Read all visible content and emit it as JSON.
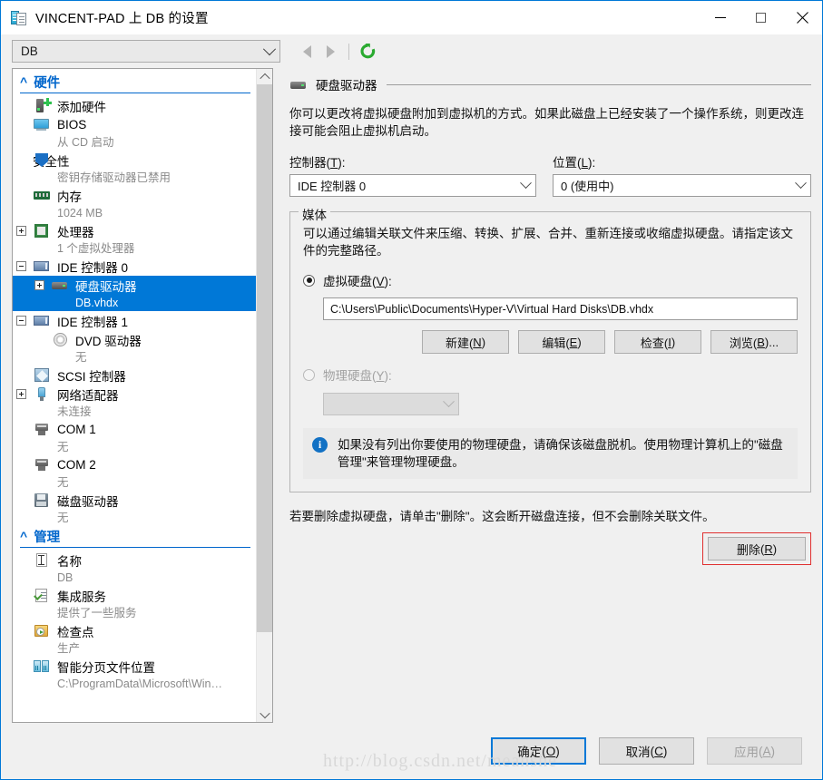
{
  "window": {
    "title": "VINCENT-PAD 上 DB 的设置",
    "icon": "vm-settings-icon",
    "minimize_label": "—",
    "maximize_label": "□",
    "close_label": "✕"
  },
  "toolbar": {
    "vm_selector_value": "DB",
    "back_icon": "back-arrow-icon",
    "forward_icon": "forward-arrow-icon",
    "refresh_icon": "refresh-icon"
  },
  "sidebar": {
    "sections": [
      {
        "title": "硬件",
        "items": [
          {
            "label": "添加硬件",
            "sub": "",
            "icon": "add-hardware-icon",
            "expander": "",
            "indent": false,
            "selected": false
          },
          {
            "label": "BIOS",
            "sub": "从 CD 启动",
            "icon": "bios-icon",
            "expander": "",
            "indent": false,
            "selected": false
          },
          {
            "label": "安全性",
            "sub": "密钥存储驱动器已禁用",
            "icon": "security-shield-icon",
            "expander": "",
            "indent": false,
            "selected": false
          },
          {
            "label": "内存",
            "sub": "1024 MB",
            "icon": "memory-icon",
            "expander": "",
            "indent": false,
            "selected": false
          },
          {
            "label": "处理器",
            "sub": "1 个虚拟处理器",
            "icon": "processor-icon",
            "expander": "plus",
            "indent": false,
            "selected": false
          },
          {
            "label": "IDE 控制器 0",
            "sub": "",
            "icon": "ide-controller-icon",
            "expander": "minus",
            "indent": false,
            "selected": false
          },
          {
            "label": "硬盘驱动器",
            "sub": "DB.vhdx",
            "icon": "hard-drive-icon",
            "expander": "plus",
            "indent": true,
            "selected": true
          },
          {
            "label": "IDE 控制器 1",
            "sub": "",
            "icon": "ide-controller-icon",
            "expander": "minus",
            "indent": false,
            "selected": false
          },
          {
            "label": "DVD 驱动器",
            "sub": "无",
            "icon": "dvd-drive-icon",
            "expander": "",
            "indent": true,
            "selected": false
          },
          {
            "label": "SCSI 控制器",
            "sub": "",
            "icon": "scsi-controller-icon",
            "expander": "",
            "indent": false,
            "selected": false
          },
          {
            "label": "网络适配器",
            "sub": "未连接",
            "icon": "network-adapter-icon",
            "expander": "plus",
            "indent": false,
            "selected": false
          },
          {
            "label": "COM 1",
            "sub": "无",
            "icon": "com-port-icon",
            "expander": "",
            "indent": false,
            "selected": false
          },
          {
            "label": "COM 2",
            "sub": "无",
            "icon": "com-port-icon",
            "expander": "",
            "indent": false,
            "selected": false
          },
          {
            "label": "磁盘驱动器",
            "sub": "无",
            "icon": "floppy-drive-icon",
            "expander": "",
            "indent": false,
            "selected": false
          }
        ]
      },
      {
        "title": "管理",
        "items": [
          {
            "label": "名称",
            "sub": "DB",
            "icon": "name-icon",
            "expander": "",
            "indent": false,
            "selected": false
          },
          {
            "label": "集成服务",
            "sub": "提供了一些服务",
            "icon": "integration-services-icon",
            "expander": "",
            "indent": false,
            "selected": false
          },
          {
            "label": "检查点",
            "sub": "生产",
            "icon": "checkpoint-icon",
            "expander": "",
            "indent": false,
            "selected": false
          },
          {
            "label": "智能分页文件位置",
            "sub": "C:\\ProgramData\\Microsoft\\Win…",
            "icon": "smart-paging-icon",
            "expander": "",
            "indent": false,
            "selected": false
          }
        ]
      }
    ]
  },
  "main": {
    "header_title": "硬盘驱动器",
    "header_icon": "hard-drive-icon",
    "description": "你可以更改将虚拟硬盘附加到虚拟机的方式。如果此磁盘上已经安装了一个操作系统，则更改连接可能会阻止虚拟机启动。",
    "controller": {
      "label": "控制器(T):",
      "label_text": "控制器",
      "accel": "T",
      "value": "IDE 控制器 0"
    },
    "location": {
      "label": "位置(L):",
      "label_text": "位置",
      "accel": "L",
      "value": "0 (使用中)"
    },
    "media": {
      "legend": "媒体",
      "description": "可以通过编辑关联文件来压缩、转换、扩展、合并、重新连接或收缩虚拟硬盘。请指定该文件的完整路径。",
      "virtual_disk": {
        "label_text": "虚拟硬盘",
        "accel": "V",
        "suffix": ":",
        "checked": true,
        "path_value": "C:\\Users\\Public\\Documents\\Hyper-V\\Virtual Hard Disks\\DB.vhdx"
      },
      "buttons": [
        {
          "label_text": "新建",
          "accel": "N",
          "suffix": ""
        },
        {
          "label_text": "编辑",
          "accel": "E",
          "suffix": ""
        },
        {
          "label_text": "检查",
          "accel": "I",
          "suffix": ""
        },
        {
          "label_text": "浏览",
          "accel": "B",
          "suffix": "..."
        }
      ],
      "physical_disk": {
        "label_text": "物理硬盘",
        "accel": "Y",
        "suffix": ":",
        "checked": false,
        "disabled": true,
        "value": ""
      },
      "info_icon": "info-icon",
      "info_text": "如果没有列出你要使用的物理硬盘，请确保该磁盘脱机。使用物理计算机上的\"磁盘管理\"来管理物理硬盘。"
    },
    "delete_note": "若要删除虚拟硬盘，请单击\"删除\"。这会断开磁盘连接，但不会删除关联文件。",
    "delete_button": {
      "label_text": "删除",
      "accel": "R",
      "highlighted": true
    }
  },
  "footer": {
    "ok": {
      "label_text": "确定",
      "accel": "O",
      "default": true
    },
    "cancel": {
      "label_text": "取消",
      "accel": "C"
    },
    "apply": {
      "label_text": "应用",
      "accel": "A",
      "disabled": true
    },
    "watermark": "http://blog.csdn.net/meanshe"
  },
  "colors": {
    "accent": "#0078d7",
    "selection": "#0078d7",
    "section_header": "#0066cc",
    "highlight_red": "#e03030",
    "refresh_green": "#2aaa30"
  }
}
